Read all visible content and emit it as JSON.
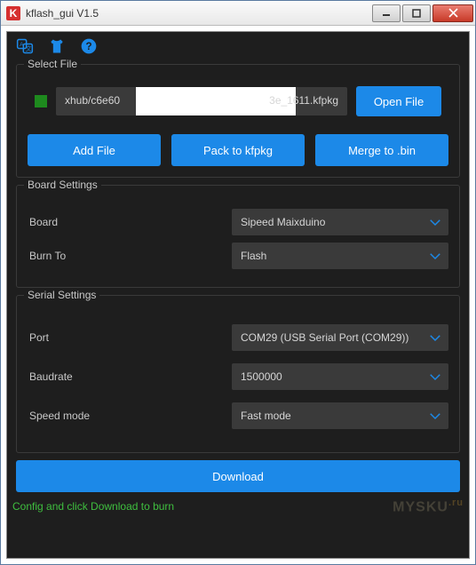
{
  "window": {
    "title": "kflash_gui V1.5"
  },
  "toolbar_icons": [
    "language-icon",
    "shirt-icon",
    "help-icon"
  ],
  "select_file": {
    "legend": "Select File",
    "path_prefix": "xhub/c6e60",
    "path_suffix": "3e_1611.kfpkg",
    "open_label": "Open File",
    "add_label": "Add File",
    "pack_label": "Pack to kfpkg",
    "merge_label": "Merge to .bin"
  },
  "board_settings": {
    "legend": "Board Settings",
    "board_label": "Board",
    "board_value": "Sipeed Maixduino",
    "burnto_label": "Burn To",
    "burnto_value": "Flash"
  },
  "serial_settings": {
    "legend": "Serial Settings",
    "port_label": "Port",
    "port_value": "COM29 (USB Serial Port (COM29))",
    "baud_label": "Baudrate",
    "baud_value": "1500000",
    "speed_label": "Speed mode",
    "speed_value": "Fast mode"
  },
  "download_label": "Download",
  "status_text": "Config and click Download to burn",
  "watermark": "MYSKU",
  "watermark_suffix": ".ru"
}
